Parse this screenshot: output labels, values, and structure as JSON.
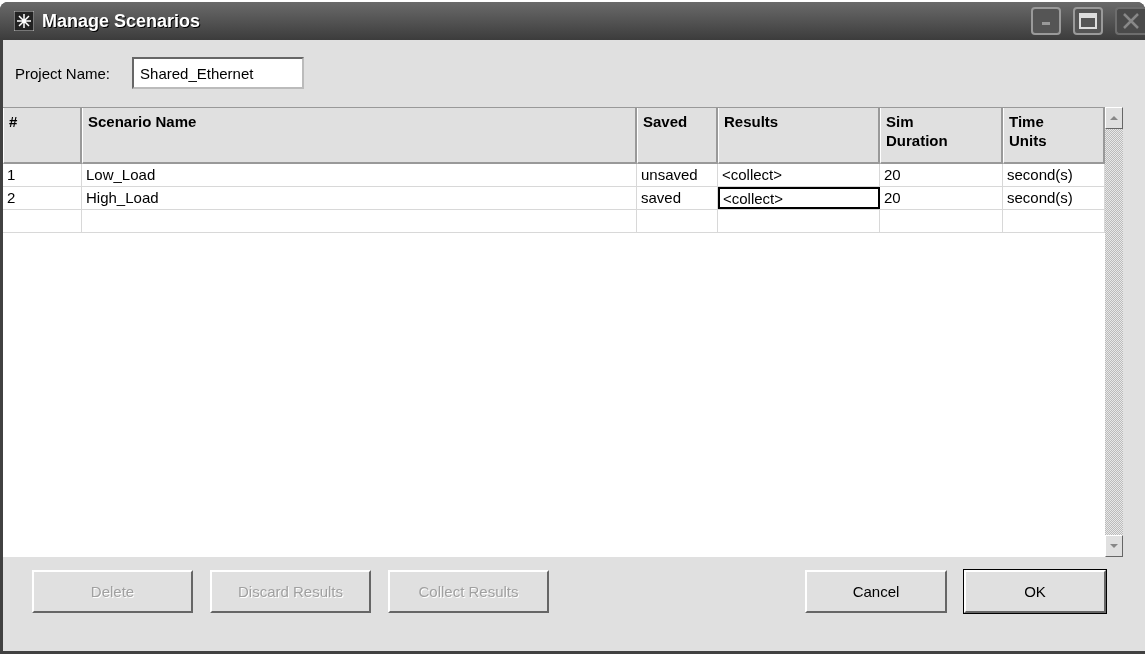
{
  "window": {
    "title": "Manage Scenarios",
    "close_disabled": true
  },
  "project": {
    "label": "Project Name:",
    "value": "Shared_Ethernet"
  },
  "table": {
    "columns": [
      "#",
      "Scenario Name",
      "Saved",
      "Results",
      "Sim Duration",
      "Time Units"
    ],
    "rows": [
      {
        "cells": [
          {
            "text": "1",
            "focused": false
          },
          {
            "text": "Low_Load",
            "focused": false
          },
          {
            "text": "unsaved",
            "focused": false
          },
          {
            "text": "<collect>",
            "focused": false
          },
          {
            "text": "20",
            "focused": false
          },
          {
            "text": "second(s)",
            "focused": false
          }
        ]
      },
      {
        "cells": [
          {
            "text": "2",
            "focused": false
          },
          {
            "text": "High_Load",
            "focused": false
          },
          {
            "text": "saved",
            "focused": false
          },
          {
            "text": "<collect>",
            "focused": true
          },
          {
            "text": "20",
            "focused": false
          },
          {
            "text": "second(s)",
            "focused": false
          }
        ]
      }
    ]
  },
  "buttons_left": [
    {
      "label": "Delete",
      "disabled": true
    },
    {
      "label": "Discard Results",
      "disabled": true
    },
    {
      "label": "Collect Results",
      "disabled": true
    }
  ],
  "buttons_right": [
    {
      "label": "Cancel",
      "disabled": false,
      "default": false
    },
    {
      "label": "OK",
      "disabled": false,
      "default": true
    }
  ]
}
